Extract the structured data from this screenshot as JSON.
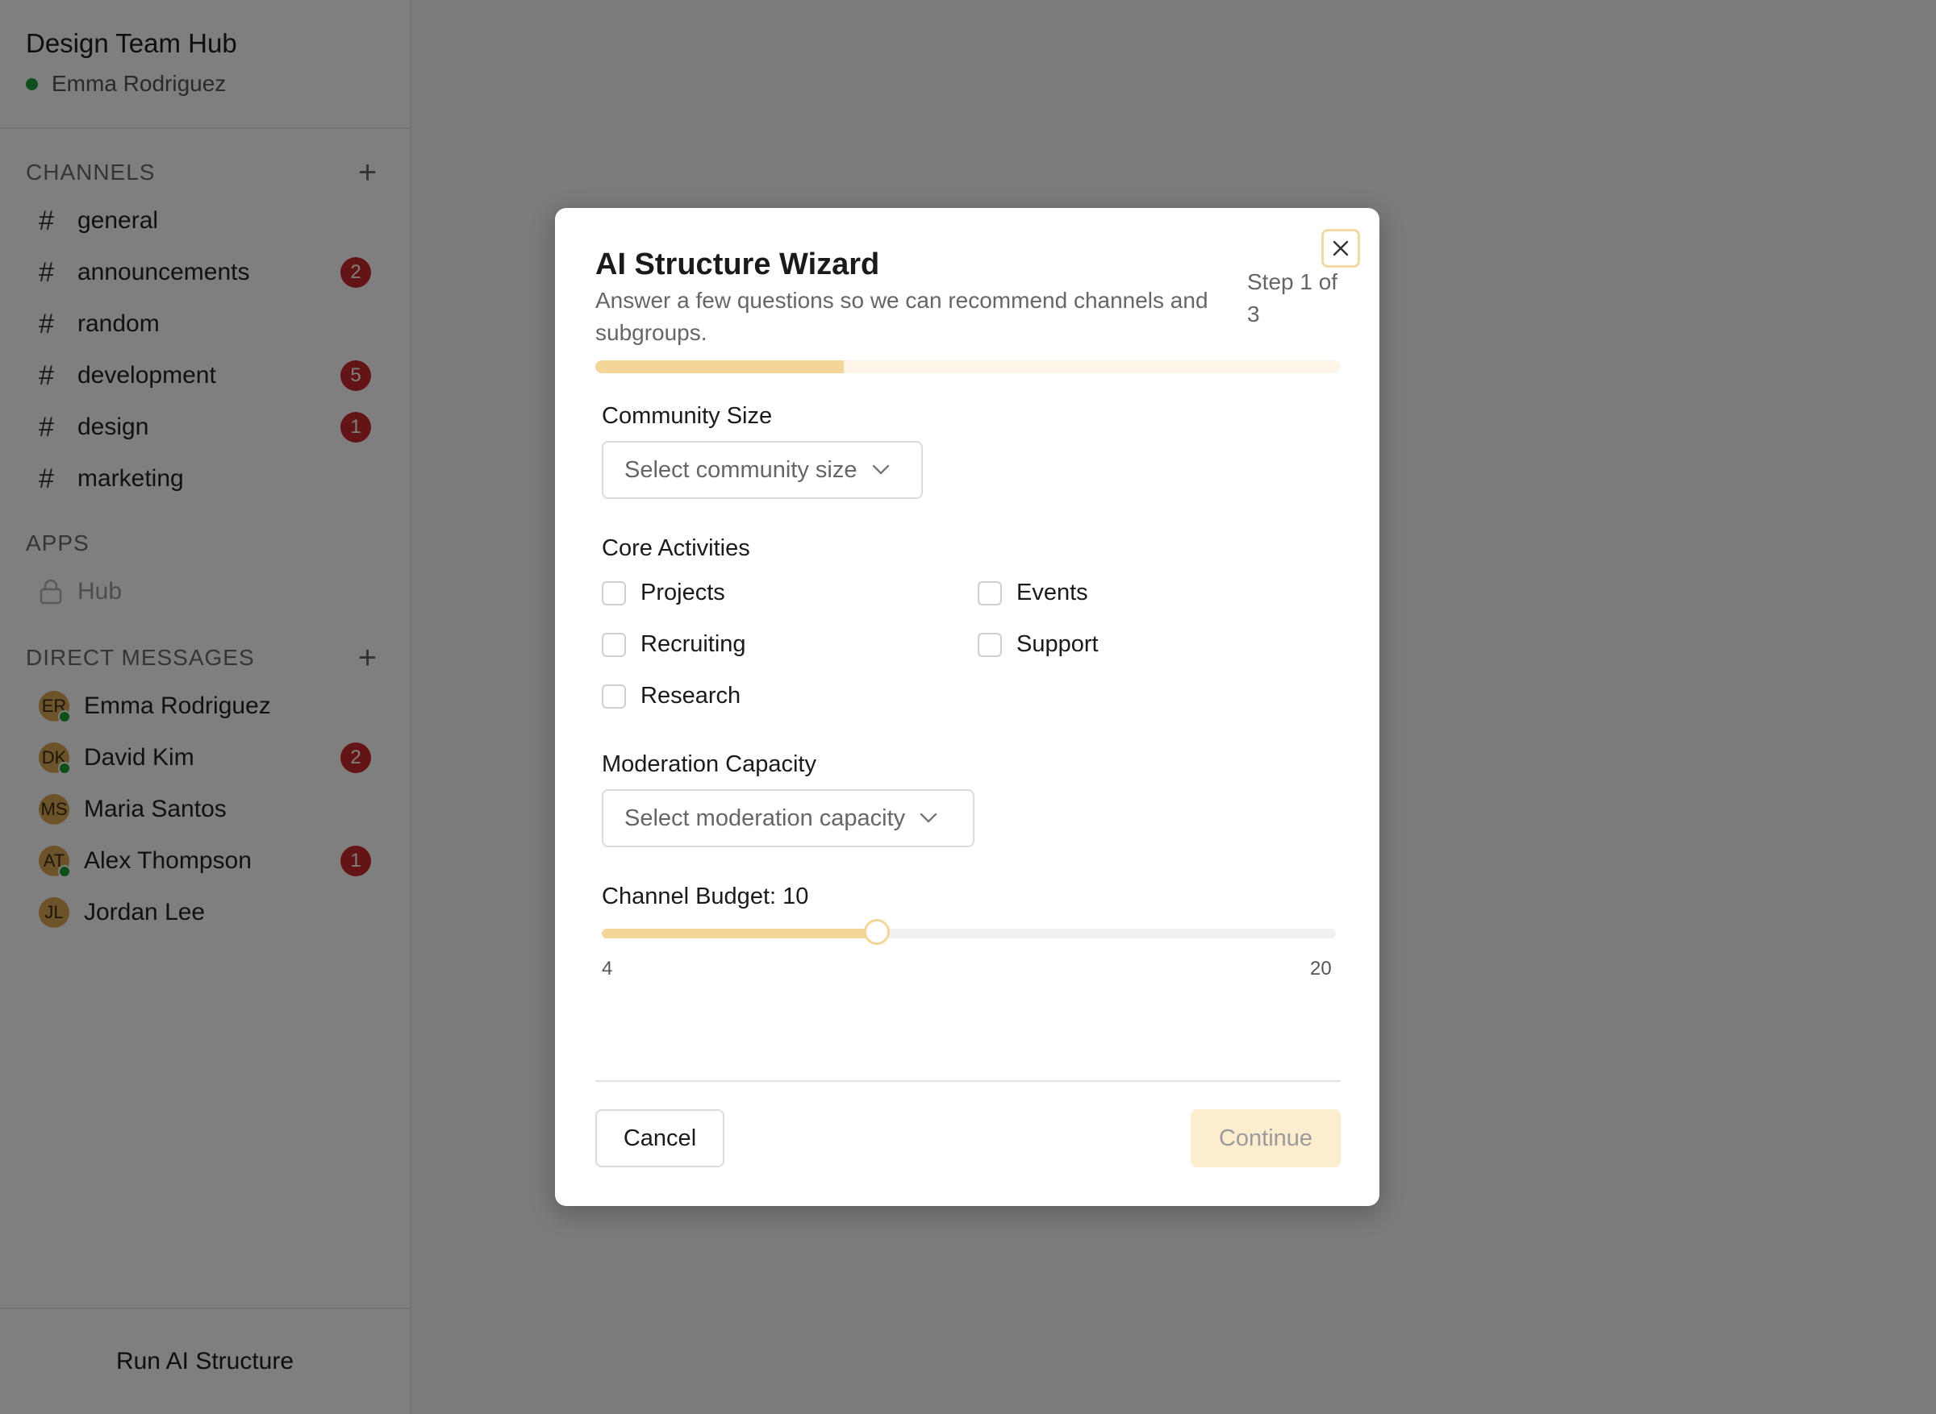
{
  "workspace": {
    "name": "Design Team Hub",
    "current_user": "Emma Rodriguez"
  },
  "sidebar": {
    "channels_header": "CHANNELS",
    "channels": [
      {
        "name": "general",
        "unread": null
      },
      {
        "name": "announcements",
        "unread": "2"
      },
      {
        "name": "random",
        "unread": null
      },
      {
        "name": "development",
        "unread": "5"
      },
      {
        "name": "design",
        "unread": "1"
      },
      {
        "name": "marketing",
        "unread": null
      }
    ],
    "apps_header": "APPS",
    "apps": [
      {
        "name": "Hub",
        "icon": "lock-icon",
        "locked": true
      }
    ],
    "dm_header": "DIRECT MESSAGES",
    "direct_messages": [
      {
        "initials": "ER",
        "name": "Emma Rodriguez",
        "online": true,
        "unread": null
      },
      {
        "initials": "DK",
        "name": "David Kim",
        "online": true,
        "unread": "2"
      },
      {
        "initials": "MS",
        "name": "Maria Santos",
        "online": false,
        "unread": null
      },
      {
        "initials": "AT",
        "name": "Alex Thompson",
        "online": true,
        "unread": "1"
      },
      {
        "initials": "JL",
        "name": "Jordan Lee",
        "online": false,
        "unread": null
      }
    ],
    "footer_button": "Run AI Structure"
  },
  "modal": {
    "title": "AI Structure Wizard",
    "subtitle": "Answer a few questions so we can recommend channels and subgroups.",
    "step_text": "Step 1 of 3",
    "progress": 0.333,
    "community_size": {
      "label": "Community Size",
      "placeholder": "Select community size"
    },
    "core_activities": {
      "label": "Core Activities",
      "options": [
        {
          "label": "Projects",
          "checked": false
        },
        {
          "label": "Events",
          "checked": false
        },
        {
          "label": "Recruiting",
          "checked": false
        },
        {
          "label": "Support",
          "checked": false
        },
        {
          "label": "Research",
          "checked": false
        }
      ]
    },
    "moderation_capacity": {
      "label": "Moderation Capacity",
      "placeholder": "Select moderation capacity"
    },
    "channel_budget": {
      "label": "Channel Budget: 10",
      "value": 10,
      "min": 4,
      "max": 20,
      "min_label": "4",
      "max_label": "20"
    },
    "cancel_label": "Cancel",
    "continue_label": "Continue",
    "continue_disabled": true
  },
  "colors": {
    "accent": "#f4d59a",
    "accent_light": "#fdedcf",
    "badge": "#c62828",
    "online": "#1f9d3a",
    "avatar": "#d9a655",
    "overlay": "rgba(0,0,0,0.5)"
  }
}
